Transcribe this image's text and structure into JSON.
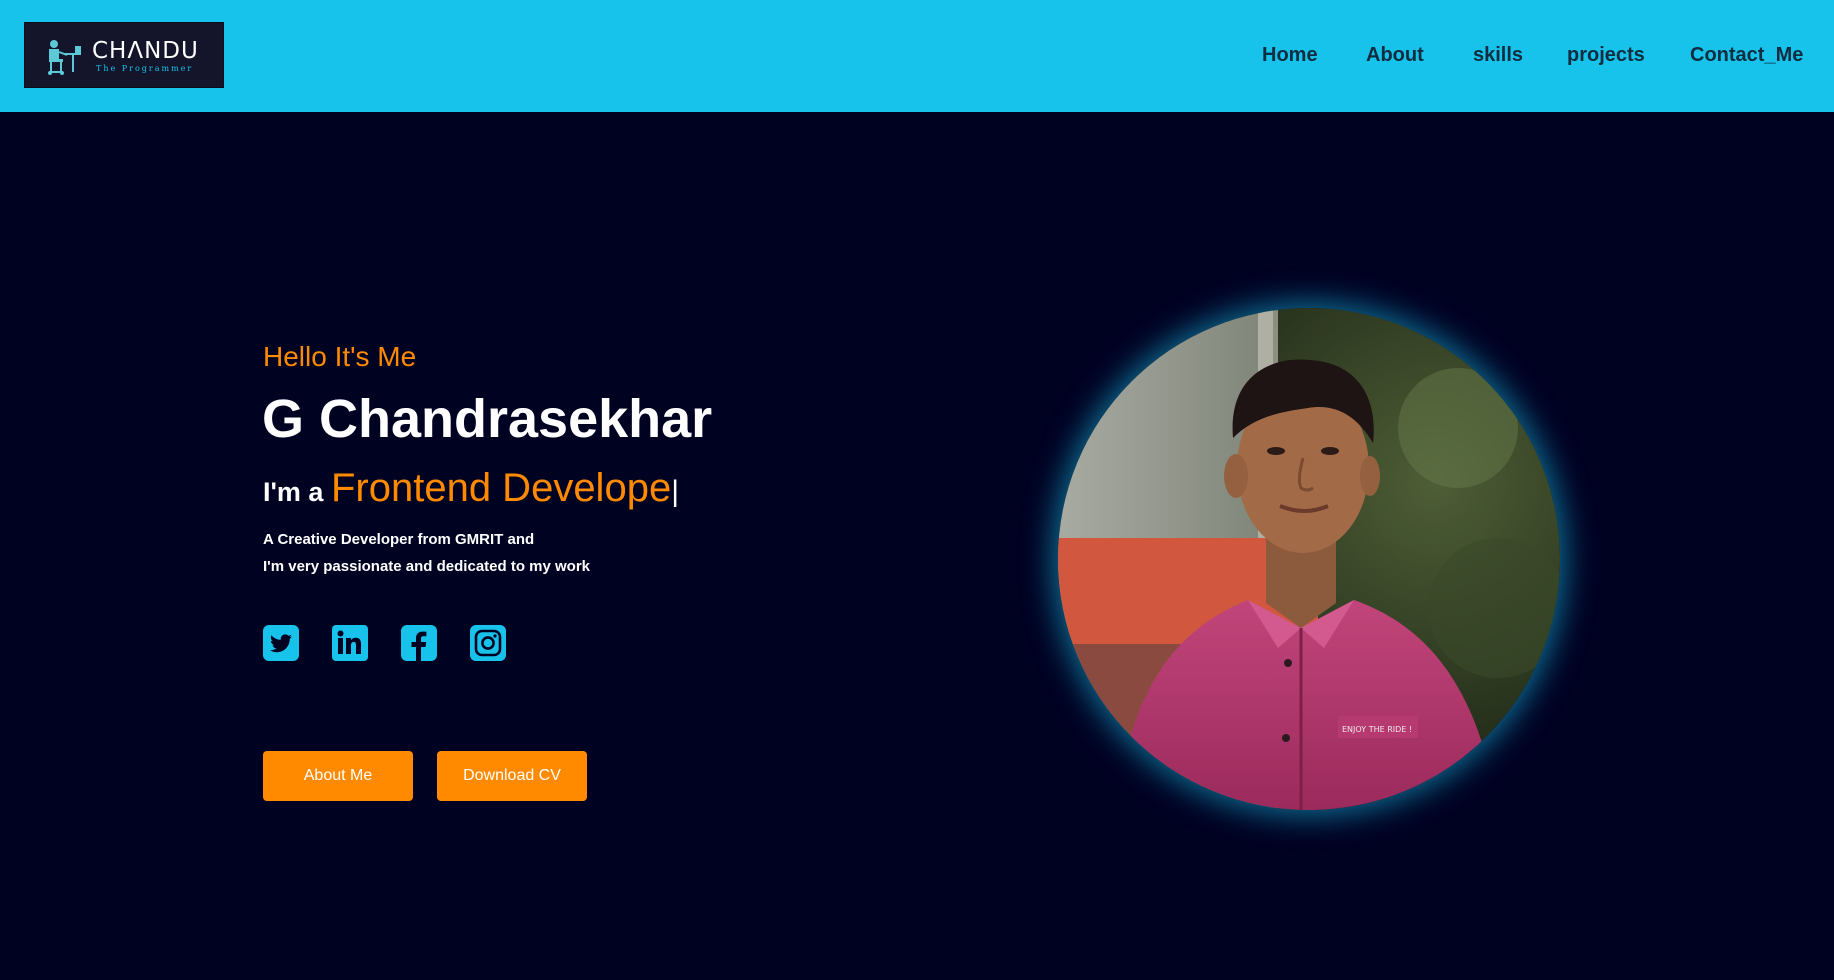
{
  "brand": {
    "title": "CHΛNDU",
    "subtitle": "The Programmer",
    "icon": "programmer-desk-icon"
  },
  "nav": {
    "items": [
      {
        "label": "Home"
      },
      {
        "label": "About"
      },
      {
        "label": "skills"
      },
      {
        "label": "projects"
      },
      {
        "label": "Contact_Me"
      }
    ]
  },
  "hero": {
    "greeting": "Hello It's Me",
    "name": "G Chandrasekhar",
    "role_prefix": "I'm a",
    "role_highlight": "Frontend Develope",
    "caret": "|",
    "description_lines": [
      "A Creative Developer from GMRIT and",
      "I'm very passionate and dedicated to my work"
    ],
    "social": [
      {
        "icon": "twitter-icon"
      },
      {
        "icon": "linkedin-icon"
      },
      {
        "icon": "facebook-icon"
      },
      {
        "icon": "instagram-icon"
      }
    ],
    "buttons": {
      "about": "About Me",
      "cv": "Download CV"
    },
    "photo_shirt_text": "ENJOY THE RIDE !"
  },
  "colors": {
    "nav_bg": "#18c3eb",
    "page_bg": "#000222",
    "accent": "#ff8a00",
    "icon": "#18c3eb"
  }
}
